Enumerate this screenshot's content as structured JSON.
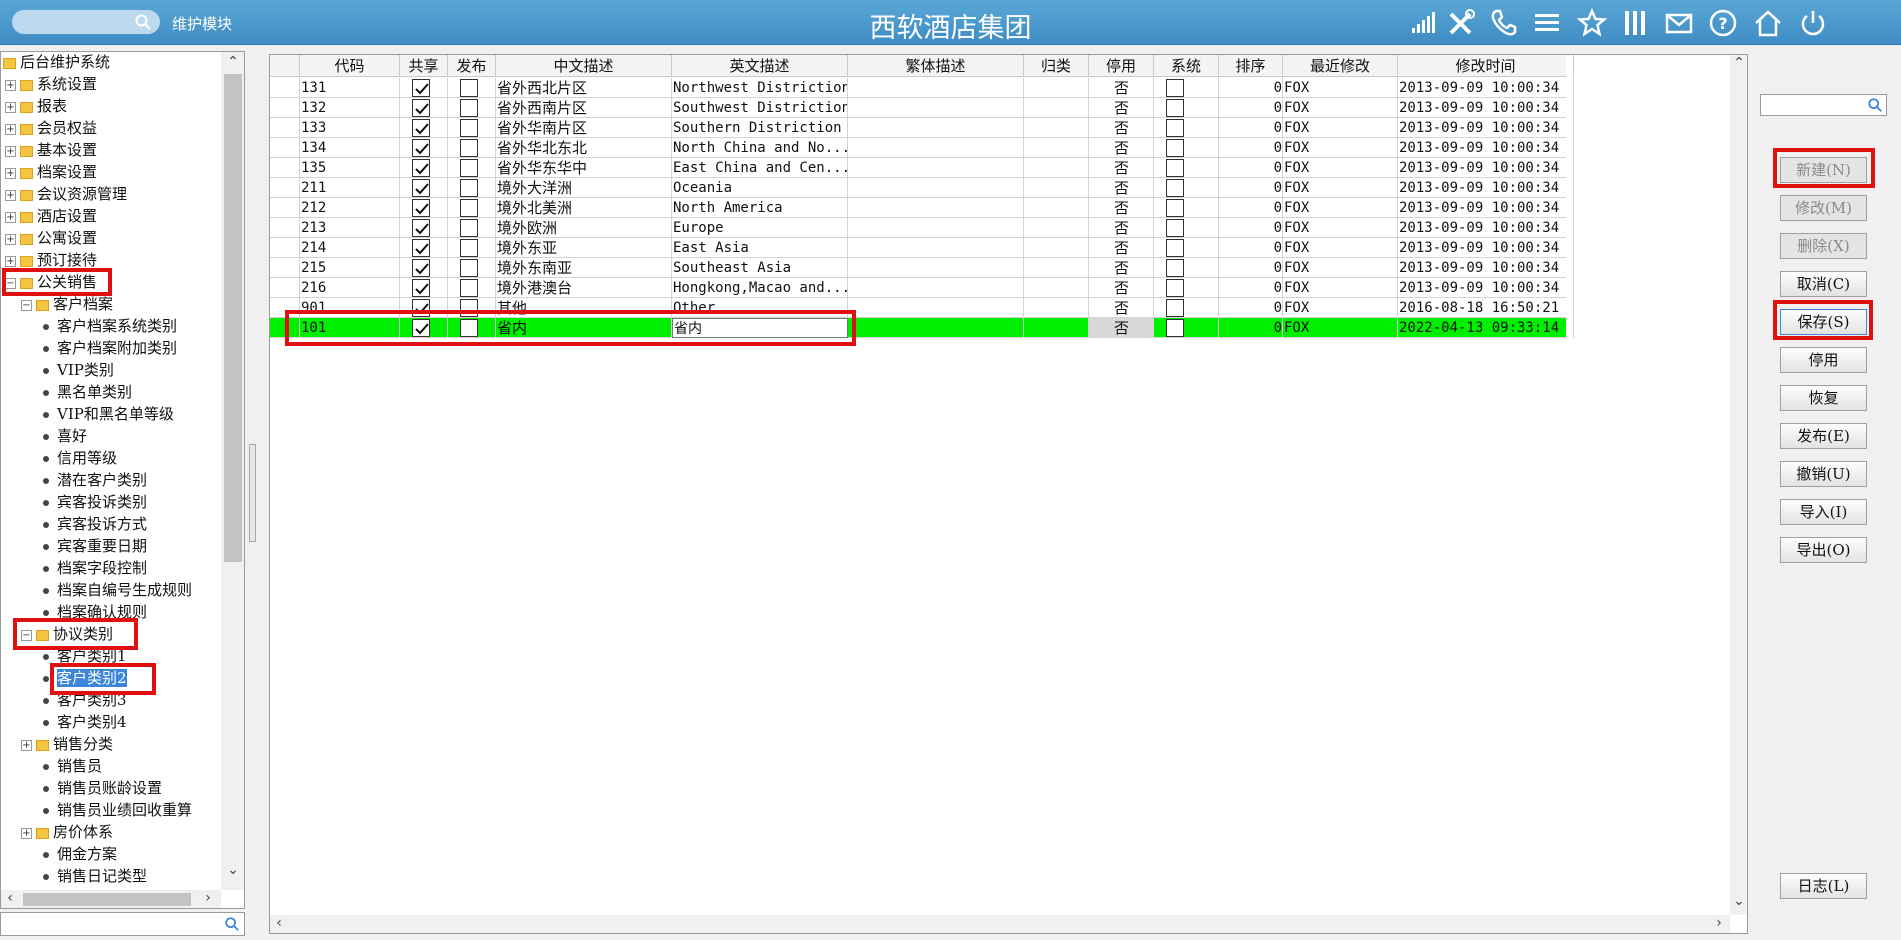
{
  "header": {
    "search_placeholder": "",
    "module_label": "维护模块",
    "title": "西软酒店集团",
    "icons": [
      "signal-icon",
      "tools-icon",
      "phone-icon",
      "menu-icon",
      "star-icon",
      "columns-icon",
      "mail-icon",
      "help-icon",
      "home-icon",
      "power-icon"
    ]
  },
  "tree": {
    "items": [
      {
        "label": "后台维护系统",
        "level": "l0",
        "type": "folder"
      },
      {
        "label": "系统设置",
        "level": "l1",
        "type": "folder-plus"
      },
      {
        "label": "报表",
        "level": "l1",
        "type": "folder-plus"
      },
      {
        "label": "会员权益",
        "level": "l1",
        "type": "folder-plus"
      },
      {
        "label": "基本设置",
        "level": "l1",
        "type": "folder-plus"
      },
      {
        "label": "档案设置",
        "level": "l1",
        "type": "folder-plus"
      },
      {
        "label": "会议资源管理",
        "level": "l1",
        "type": "folder-plus"
      },
      {
        "label": "酒店设置",
        "level": "l1",
        "type": "folder-plus"
      },
      {
        "label": "公寓设置",
        "level": "l1",
        "type": "folder-plus"
      },
      {
        "label": "预订接待",
        "level": "l1",
        "type": "folder-plus"
      },
      {
        "label": "公关销售",
        "level": "l1",
        "type": "folder-minus"
      },
      {
        "label": "客户档案",
        "level": "l2",
        "type": "folder-minus"
      },
      {
        "label": "客户档案系统类别",
        "level": "l3",
        "type": "leaf"
      },
      {
        "label": "客户档案附加类别",
        "level": "l3",
        "type": "leaf"
      },
      {
        "label": "VIP类别",
        "level": "l3",
        "type": "leaf"
      },
      {
        "label": "黑名单类别",
        "level": "l3",
        "type": "leaf"
      },
      {
        "label": "VIP和黑名单等级",
        "level": "l3",
        "type": "leaf"
      },
      {
        "label": "喜好",
        "level": "l3",
        "type": "leaf"
      },
      {
        "label": "信用等级",
        "level": "l3",
        "type": "leaf"
      },
      {
        "label": "潜在客户类别",
        "level": "l3",
        "type": "leaf"
      },
      {
        "label": "宾客投诉类别",
        "level": "l3",
        "type": "leaf"
      },
      {
        "label": "宾客投诉方式",
        "level": "l3",
        "type": "leaf"
      },
      {
        "label": "宾客重要日期",
        "level": "l3",
        "type": "leaf"
      },
      {
        "label": "档案字段控制",
        "level": "l3",
        "type": "leaf"
      },
      {
        "label": "档案自编号生成规则",
        "level": "l3",
        "type": "leaf"
      },
      {
        "label": "档案确认规则",
        "level": "l3",
        "type": "leaf"
      },
      {
        "label": "协议类别",
        "level": "l2",
        "type": "folder-minus"
      },
      {
        "label": "客户类别1",
        "level": "l3",
        "type": "leaf"
      },
      {
        "label": "客户类别2",
        "level": "l3",
        "type": "leaf",
        "selected": true
      },
      {
        "label": "客户类别3",
        "level": "l3",
        "type": "leaf"
      },
      {
        "label": "客户类别4",
        "level": "l3",
        "type": "leaf"
      },
      {
        "label": "销售分类",
        "level": "l2",
        "type": "folder-plus"
      },
      {
        "label": "销售员",
        "level": "l2c",
        "type": "leaf"
      },
      {
        "label": "销售员账龄设置",
        "level": "l2c",
        "type": "leaf"
      },
      {
        "label": "销售员业绩回收重算",
        "level": "l2c",
        "type": "leaf"
      },
      {
        "label": "房价体系",
        "level": "l2",
        "type": "folder-plus"
      },
      {
        "label": "佣金方案",
        "level": "l2c",
        "type": "leaf"
      },
      {
        "label": "销售日记类型",
        "level": "l2c",
        "type": "leaf"
      }
    ]
  },
  "grid": {
    "columns": [
      "代码",
      "共享",
      "发布",
      "中文描述",
      "英文描述",
      "繁体描述",
      "归类",
      "停用",
      "系统",
      "排序",
      "最近修改",
      "修改时间"
    ],
    "rows": [
      {
        "code": "131",
        "share": true,
        "publish": false,
        "zh": "省外西北片区",
        "en": "Northwest Distriction",
        "tw": "",
        "cat": "",
        "stop": "否",
        "sys": false,
        "order": "0",
        "by": "FOX",
        "time": "2013-09-09 10:00:34"
      },
      {
        "code": "132",
        "share": true,
        "publish": false,
        "zh": "省外西南片区",
        "en": "Southwest Distriction",
        "tw": "",
        "cat": "",
        "stop": "否",
        "sys": false,
        "order": "0",
        "by": "FOX",
        "time": "2013-09-09 10:00:34"
      },
      {
        "code": "133",
        "share": true,
        "publish": false,
        "zh": "省外华南片区",
        "en": "Southern Distriction",
        "tw": "",
        "cat": "",
        "stop": "否",
        "sys": false,
        "order": "0",
        "by": "FOX",
        "time": "2013-09-09 10:00:34"
      },
      {
        "code": "134",
        "share": true,
        "publish": false,
        "zh": "省外华北东北",
        "en": "North China and No...",
        "tw": "",
        "cat": "",
        "stop": "否",
        "sys": false,
        "order": "0",
        "by": "FOX",
        "time": "2013-09-09 10:00:34"
      },
      {
        "code": "135",
        "share": true,
        "publish": false,
        "zh": "省外华东华中",
        "en": "East China and Cen...",
        "tw": "",
        "cat": "",
        "stop": "否",
        "sys": false,
        "order": "0",
        "by": "FOX",
        "time": "2013-09-09 10:00:34"
      },
      {
        "code": "211",
        "share": true,
        "publish": false,
        "zh": "境外大洋洲",
        "en": "Oceania",
        "tw": "",
        "cat": "",
        "stop": "否",
        "sys": false,
        "order": "0",
        "by": "FOX",
        "time": "2013-09-09 10:00:34"
      },
      {
        "code": "212",
        "share": true,
        "publish": false,
        "zh": "境外北美洲",
        "en": "North America",
        "tw": "",
        "cat": "",
        "stop": "否",
        "sys": false,
        "order": "0",
        "by": "FOX",
        "time": "2013-09-09 10:00:34"
      },
      {
        "code": "213",
        "share": true,
        "publish": false,
        "zh": "境外欧洲",
        "en": "Europe",
        "tw": "",
        "cat": "",
        "stop": "否",
        "sys": false,
        "order": "0",
        "by": "FOX",
        "time": "2013-09-09 10:00:34"
      },
      {
        "code": "214",
        "share": true,
        "publish": false,
        "zh": "境外东亚",
        "en": "East Asia",
        "tw": "",
        "cat": "",
        "stop": "否",
        "sys": false,
        "order": "0",
        "by": "FOX",
        "time": "2013-09-09 10:00:34"
      },
      {
        "code": "215",
        "share": true,
        "publish": false,
        "zh": "境外东南亚",
        "en": "Southeast Asia",
        "tw": "",
        "cat": "",
        "stop": "否",
        "sys": false,
        "order": "0",
        "by": "FOX",
        "time": "2013-09-09 10:00:34"
      },
      {
        "code": "216",
        "share": true,
        "publish": false,
        "zh": "境外港澳台",
        "en": "Hongkong,Macao and...",
        "tw": "",
        "cat": "",
        "stop": "否",
        "sys": false,
        "order": "0",
        "by": "FOX",
        "time": "2013-09-09 10:00:34"
      },
      {
        "code": "901",
        "share": true,
        "publish": false,
        "zh": "其他",
        "en": "Other",
        "tw": "",
        "cat": "",
        "stop": "否",
        "sys": false,
        "order": "0",
        "by": "FOX",
        "time": "2016-08-18 16:50:21"
      },
      {
        "code": "101",
        "share": true,
        "publish": false,
        "zh": "省内",
        "en": "省内",
        "tw": "",
        "cat": "",
        "stop": "否",
        "sys": false,
        "order": "0",
        "by": "FOX",
        "time": "2022-04-13 09:33:14",
        "active": true
      }
    ]
  },
  "right_panel": {
    "search_placeholder": "",
    "buttons": [
      {
        "label": "新建(N)",
        "state": "disabled"
      },
      {
        "label": "修改(M)",
        "state": "disabled"
      },
      {
        "label": "删除(X)",
        "state": "disabled"
      },
      {
        "label": "取消(C)",
        "state": "normal"
      },
      {
        "label": "保存(S)",
        "state": "focused"
      },
      {
        "label": "停用",
        "state": "normal"
      },
      {
        "label": "恢复",
        "state": "normal"
      },
      {
        "label": "发布(E)",
        "state": "normal"
      },
      {
        "label": "撤销(U)",
        "state": "normal"
      },
      {
        "label": "导入(I)",
        "state": "normal"
      },
      {
        "label": "导出(O)",
        "state": "normal"
      }
    ],
    "log_button": "日志(L)"
  },
  "colors": {
    "header": "#4a9ad0",
    "active_row": "#00ee00",
    "highlight": "#e01010",
    "selection": "#3b86d8"
  }
}
